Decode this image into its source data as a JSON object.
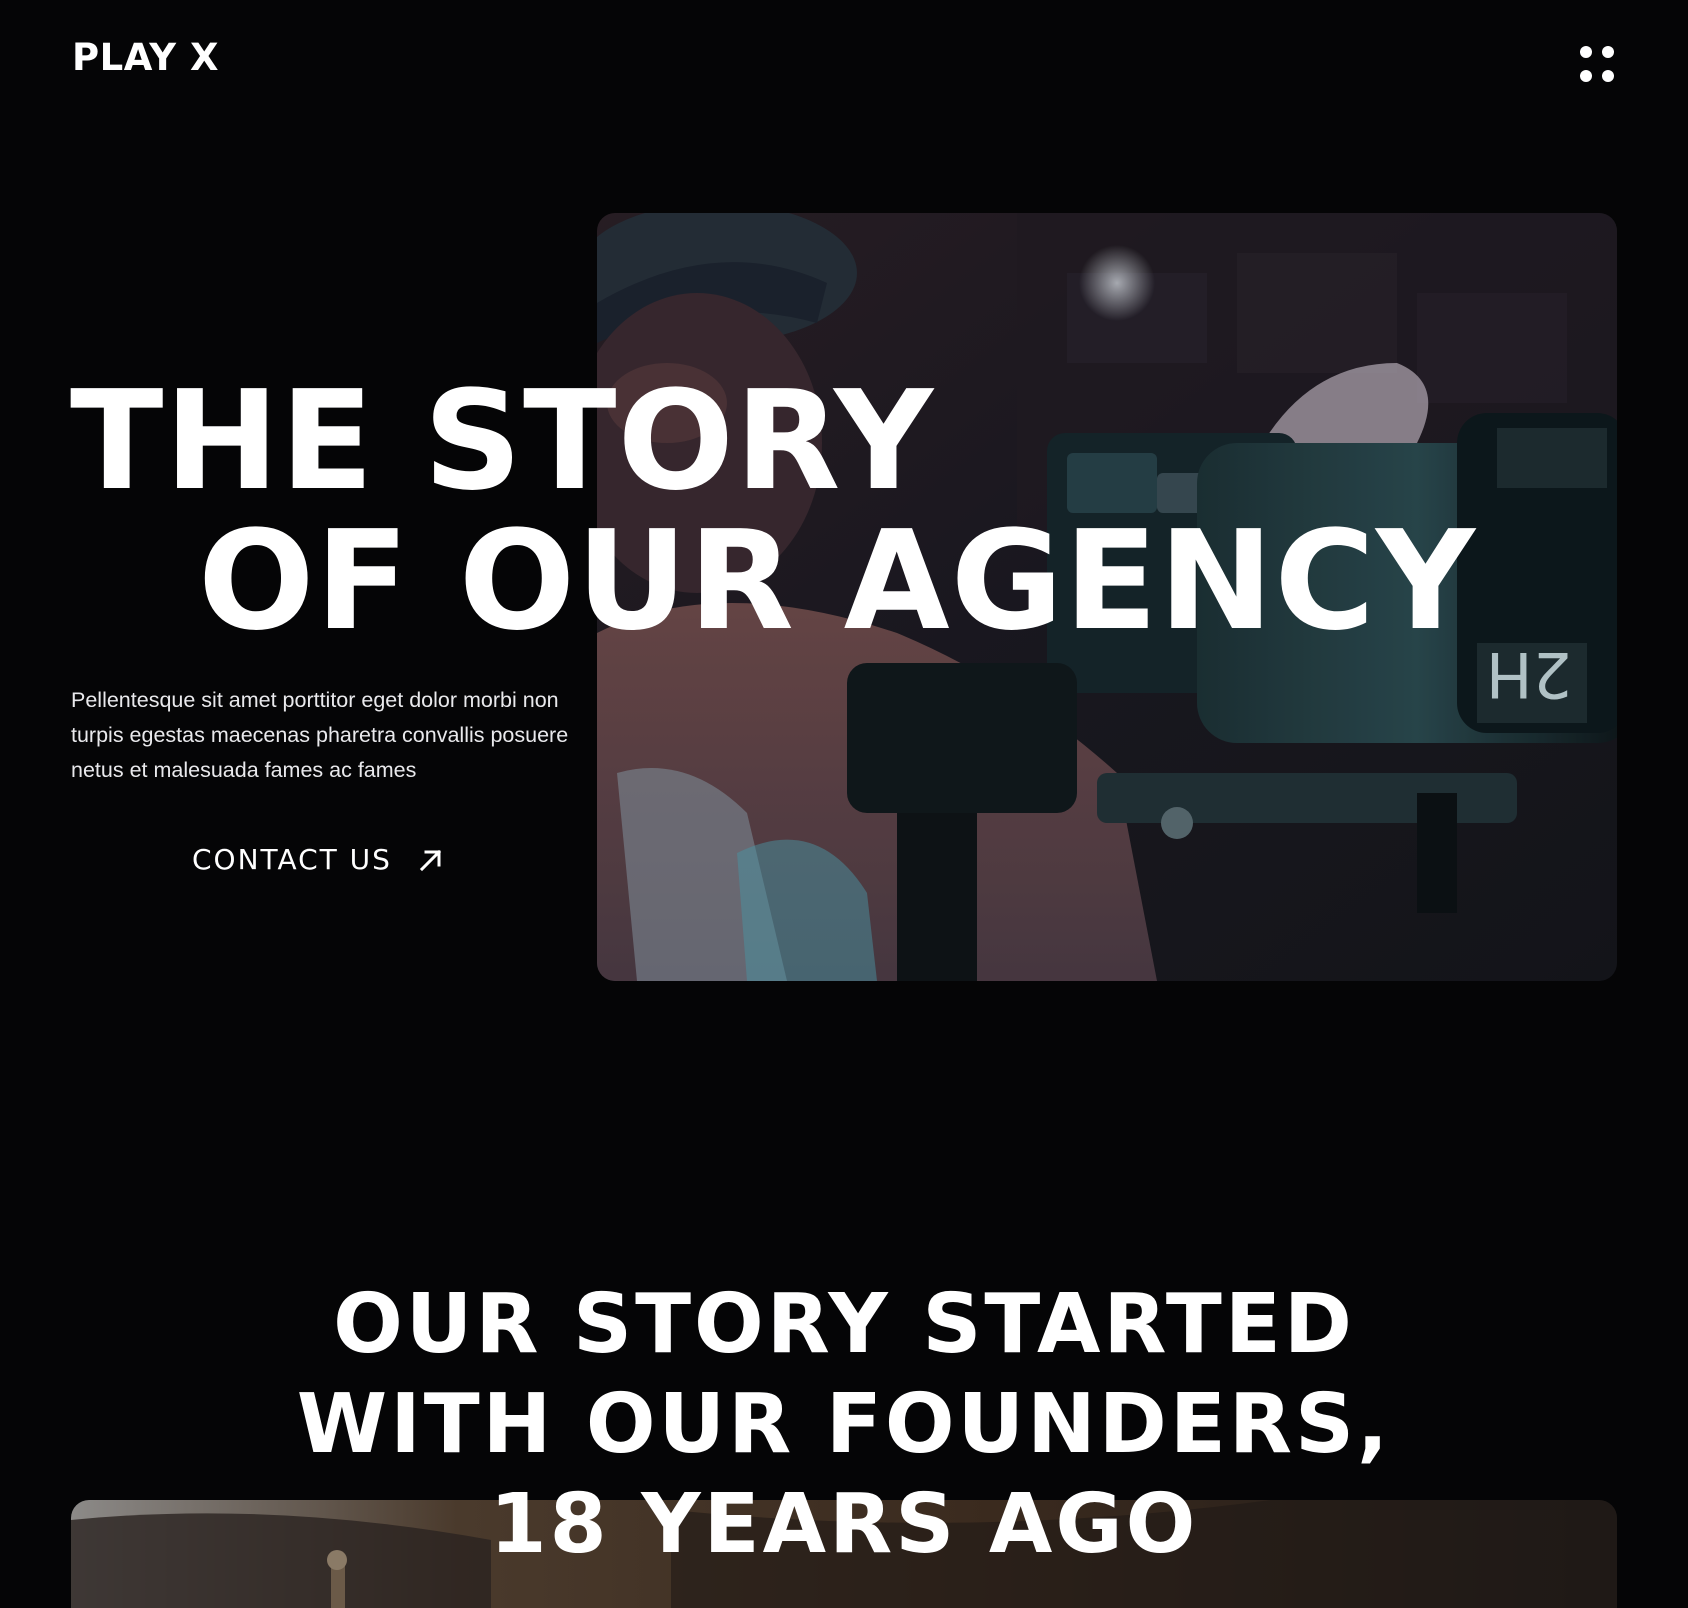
{
  "header": {
    "logo": "PLAY X",
    "menu_icon": "grid-dots-icon"
  },
  "hero": {
    "title_line1": "THE STORY",
    "title_line2": "OF OUR AGENCY",
    "description": "Pellentesque sit amet porttitor eget dolor morbi non turpis egestas maecenas pharetra convallis posuere netus et malesuada fames ac fames",
    "cta_label": "CONTACT US",
    "cta_icon": "arrow-up-right-icon",
    "image_alt": "videographer-with-cinema-camera-photo"
  },
  "story": {
    "title_line1": "OUR STORY STARTED",
    "title_line2": "WITH OUR FOUNDERS,",
    "title_line3": "18 YEARS AGO",
    "image_alt": "founders-photo"
  },
  "colors": {
    "background": "#050506",
    "text": "#ffffff"
  }
}
